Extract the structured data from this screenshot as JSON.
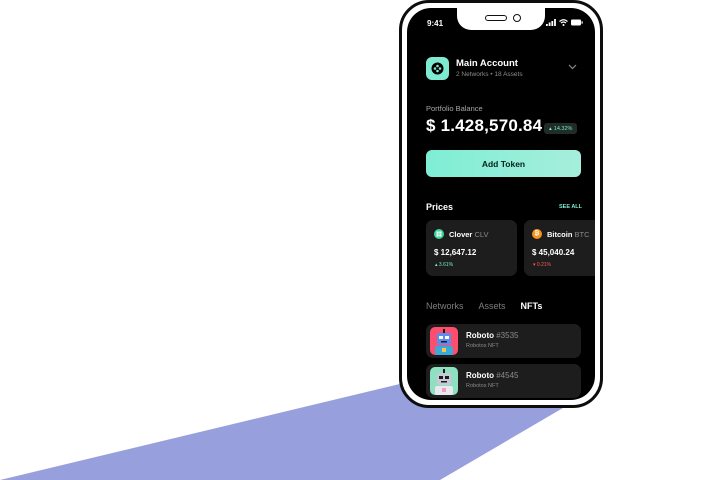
{
  "status_bar": {
    "time": "9:41"
  },
  "account": {
    "name": "Main Account",
    "meta": "2 Networks  •  18 Assets"
  },
  "portfolio": {
    "label": "Portfolio Balance",
    "value": "$ 1.428,570.84",
    "change": "14.32%",
    "change_color": "#7eead2"
  },
  "add_token_label": "Add Token",
  "prices": {
    "title": "Prices",
    "see_all": "SEE ALL",
    "cards": [
      {
        "name": "Clover",
        "symbol": "CLV",
        "price": "$ 12,647.12",
        "change": "3.61%",
        "direction": "up",
        "change_color": "#7eead2",
        "coin_color": "#3dd69a",
        "icon": "clover-coin-icon"
      },
      {
        "name": "Bitcoin",
        "symbol": "BTC",
        "price": "$ 45,040.24",
        "change": "0.21%",
        "direction": "down",
        "change_color": "#ff5a5a",
        "coin_color": "#f7931a",
        "icon": "bitcoin-coin-icon"
      }
    ]
  },
  "tabs": [
    {
      "label": "Networks",
      "active": false
    },
    {
      "label": "Assets",
      "active": false
    },
    {
      "label": "NFTs",
      "active": true
    }
  ],
  "nfts": [
    {
      "name": "Roboto",
      "number": "#3535",
      "collection": "Robotos NFT",
      "bg_color": "#ff4d6d"
    },
    {
      "name": "Roboto",
      "number": "#4545",
      "collection": "Robotos NFT",
      "bg_color": "#8ee0c0"
    }
  ],
  "colors": {
    "accent": "#7eead2",
    "background_shape": "#97a0dc",
    "screen": "#000000",
    "card": "#1d1d1d"
  }
}
